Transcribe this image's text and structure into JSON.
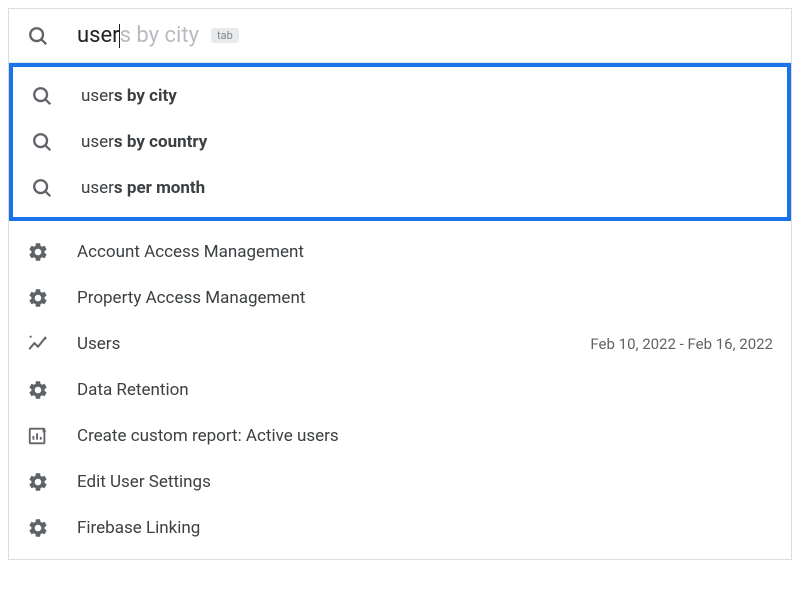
{
  "search": {
    "typed": "user",
    "ghost": "s by city",
    "tab_hint": "tab"
  },
  "suggestions": [
    {
      "prefix": "user",
      "bold": "s by city"
    },
    {
      "prefix": "user",
      "bold": "s by country"
    },
    {
      "prefix": "user",
      "bold": "s per month"
    }
  ],
  "results": [
    {
      "icon": "gear",
      "label": "Account Access Management",
      "meta": ""
    },
    {
      "icon": "gear",
      "label": "Property Access Management",
      "meta": ""
    },
    {
      "icon": "trend",
      "label": "Users",
      "meta": "Feb 10, 2022 - Feb 16, 2022"
    },
    {
      "icon": "gear",
      "label": "Data Retention",
      "meta": ""
    },
    {
      "icon": "report",
      "label": "Create custom report: Active users",
      "meta": ""
    },
    {
      "icon": "gear",
      "label": "Edit User Settings",
      "meta": ""
    },
    {
      "icon": "gear",
      "label": "Firebase Linking",
      "meta": ""
    }
  ]
}
